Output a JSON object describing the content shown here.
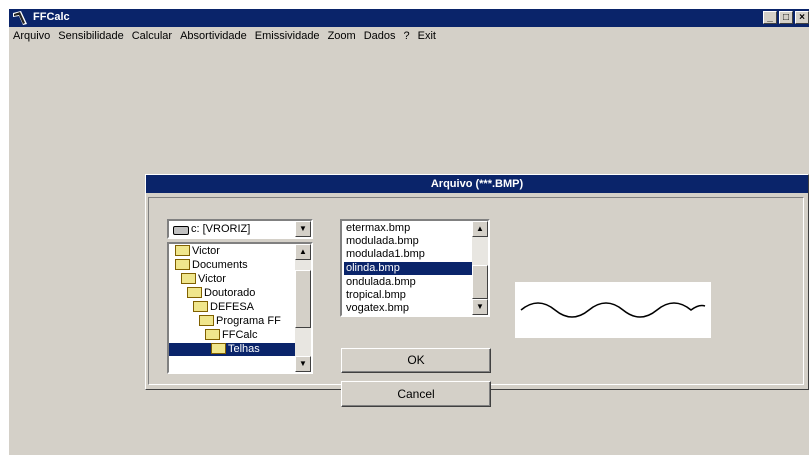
{
  "window": {
    "title": "FFCalc",
    "controls": [
      "_",
      "□",
      "×"
    ]
  },
  "menu": [
    "Arquivo",
    "Sensibilidade",
    "Calcular",
    "Absortividade",
    "Emissividade",
    "Zoom",
    "Dados",
    "?",
    "Exit"
  ],
  "dialog": {
    "title": "Arquivo  (***.BMP)",
    "drive": "c: [VRORIZ]",
    "directories": [
      "Victor",
      "Documents",
      "Victor",
      "Doutorado",
      "DEFESA",
      "Programa FF",
      "FFCalc",
      "Telhas"
    ],
    "selected_directory": "Telhas",
    "files": [
      "etermax.bmp",
      "modulada.bmp",
      "modulada1.bmp",
      "olinda.bmp",
      "ondulada.bmp",
      "tropical.bmp",
      "vogatex.bmp"
    ],
    "selected_file": "olinda.bmp",
    "ok_label": "OK",
    "cancel_label": "Cancel"
  },
  "colors": {
    "titlebar": "#0a246a",
    "face": "#d4d0c8",
    "selection": "#0a246a"
  }
}
